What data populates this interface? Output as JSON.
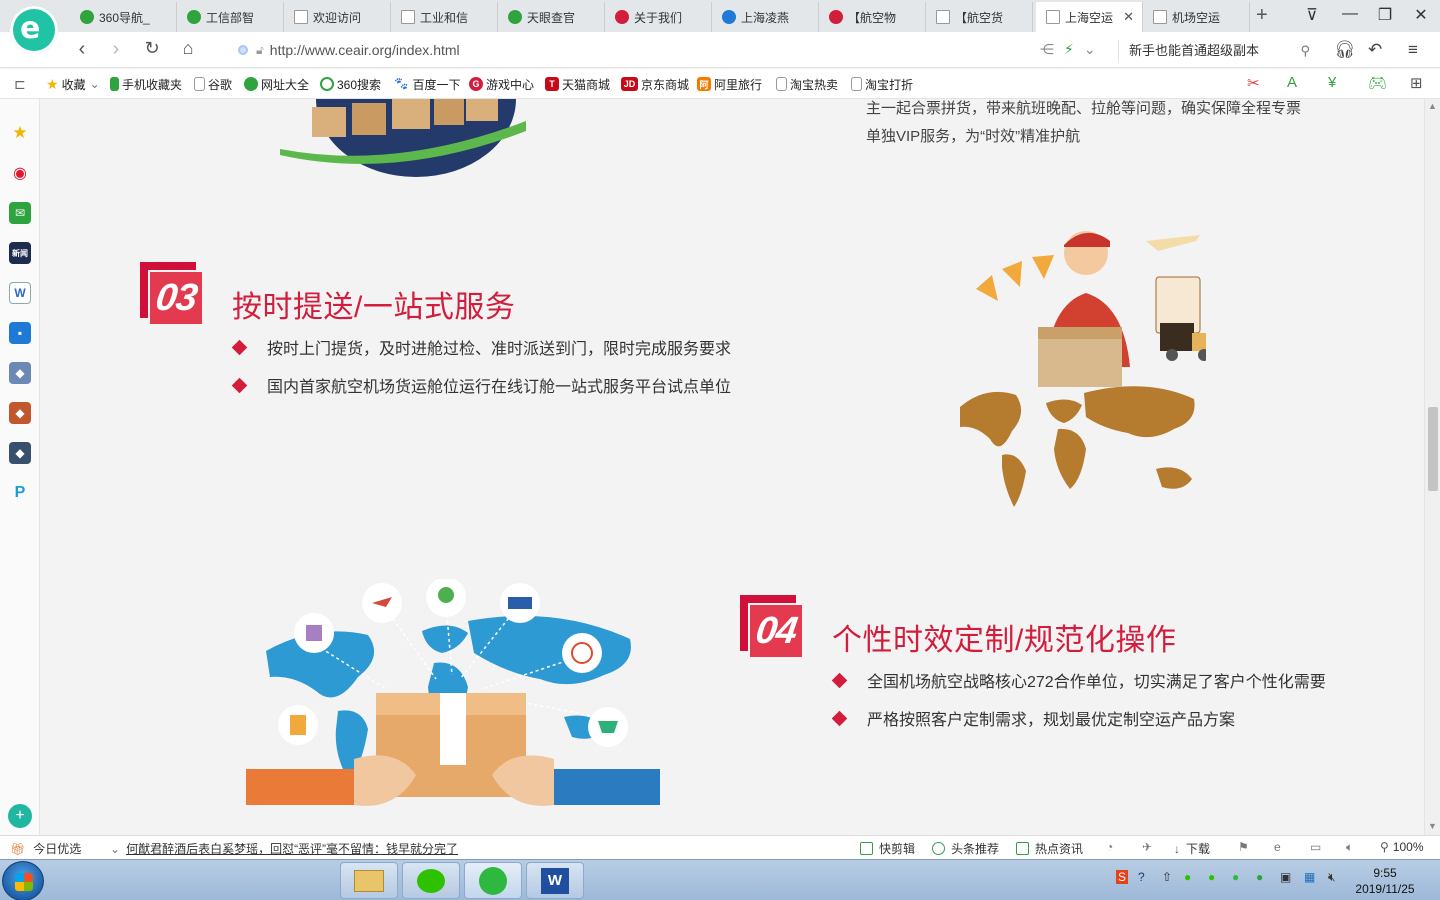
{
  "browser": {
    "tabs": [
      {
        "label": "360导航_",
        "color": "#2fa33e"
      },
      {
        "label": "工信部智",
        "color": "#2fa33e"
      },
      {
        "label": "欢迎访问",
        "color": "#bbbbbb"
      },
      {
        "label": "工业和信",
        "color": "#bbbbbb"
      },
      {
        "label": "天眼查官",
        "color": "#2fa33e"
      },
      {
        "label": "关于我们",
        "color": "#d11f3b"
      },
      {
        "label": "上海凌燕",
        "color": "#1f7ad6"
      },
      {
        "label": "【航空物",
        "color": "#d11f3b"
      },
      {
        "label": "【航空货",
        "color": "#bbbbbb"
      },
      {
        "label": "上海空运",
        "color": "#bbbbbb",
        "active": true
      },
      {
        "label": "机场空运",
        "color": "#bbbbbb"
      }
    ],
    "url": "http://www.ceair.org/index.html",
    "search_hint": "新手也能首通超级副本",
    "bookmarks": [
      {
        "label": "收藏",
        "icon": "star-icon",
        "color": "#f2b400"
      },
      {
        "label": "手机收藏夹",
        "icon": "phone-icon",
        "color": "#2fa33e"
      },
      {
        "label": "谷歌",
        "icon": "page-icon",
        "color": "#cccccc"
      },
      {
        "label": "网址大全",
        "icon": "360-icon",
        "color": "#2fa33e"
      },
      {
        "label": "360搜索",
        "icon": "search-360-icon",
        "color": "#2fa33e"
      },
      {
        "label": "百度一下",
        "icon": "baidu-icon",
        "color": "#2f6fd6"
      },
      {
        "label": "游戏中心",
        "icon": "game-icon",
        "color": "#d11f3b"
      },
      {
        "label": "天猫商城",
        "icon": "tmall-icon",
        "color": "#c80a18",
        "glyph": "T"
      },
      {
        "label": "京东商城",
        "icon": "jd-icon",
        "color": "#c80a18",
        "glyph": "JD"
      },
      {
        "label": "阿里旅行",
        "icon": "alitrip-icon",
        "color": "#f57a00",
        "glyph": "阿"
      },
      {
        "label": "淘宝热卖",
        "icon": "page-icon",
        "color": "#cccccc"
      },
      {
        "label": "淘宝打折",
        "icon": "page-icon",
        "color": "#cccccc"
      }
    ]
  },
  "page": {
    "prev_section_lines": [
      "主一起合票拼货，带来航班晚配、拉舱等问题，确实保障全程专票",
      "单独VIP服务，为“时效”精准护航"
    ],
    "section3": {
      "number": "03",
      "title": "按时提送/一站式服务",
      "bullets": [
        "按时上门提货，及时进舱过检、准时派送到门，限时完成服务要求",
        "国内首家航空机场货运舱位运行在线订舱一站式服务平台试点单位"
      ]
    },
    "section4": {
      "number": "04",
      "title": "个性时效定制/规范化操作",
      "bullets": [
        "全国机场航空战略核心272合作单位，切实满足了客户个性化需要",
        "严格按照客户定制需求，规划最优定制空运产品方案"
      ]
    },
    "accent_color": "#d21d3d"
  },
  "statusbar": {
    "left_label": "今日优选",
    "news": "何猷君醉酒后表白奚梦瑶，回怼“恶评”毫不留情：钱早就分完了",
    "items": [
      "快剪辑",
      "头条推荐",
      "热点资讯",
      "下载"
    ],
    "zoom": "100%"
  },
  "taskbar": {
    "time": "9:55",
    "date": "2019/11/25"
  }
}
